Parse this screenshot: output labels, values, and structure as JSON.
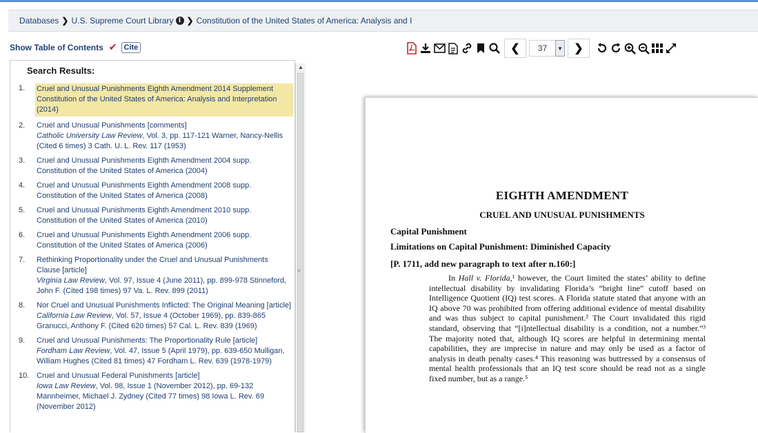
{
  "breadcrumb": {
    "items": [
      "Databases",
      "U.S. Supreme Court Library",
      "Constitution of the United States of America: Analysis and I"
    ]
  },
  "toc": {
    "show_label": "Show Table of Contents",
    "cite_label": "Cite"
  },
  "toolbar": {
    "page_number": "37"
  },
  "search": {
    "title": "Search Results:",
    "results": [
      {
        "num": "1.",
        "title": "Cruel and Unusual Punishments Eighth Amendment 2014 Supplement Constitution of the United States of America: Analysis and Interpretation (2014)",
        "journal": "",
        "rest": ""
      },
      {
        "num": "2.",
        "title": "Cruel and Unusual Punishments [comments]",
        "journal": "Catholic University Law Review",
        "rest": ", Vol. 3, pp. 117-121 Warner, Nancy-Nellis (Cited 6 times) 3 Cath. U. L. Rev. 117 (1953)"
      },
      {
        "num": "3.",
        "title": "Cruel and Unusual Punishments Eighth Amendment 2004 supp. Constitution of the United States of America (2004)",
        "journal": "",
        "rest": ""
      },
      {
        "num": "4.",
        "title": "Cruel and Unusual Punishments Eighth Amendment 2008 supp. Constitution of the United States of America (2008)",
        "journal": "",
        "rest": ""
      },
      {
        "num": "5.",
        "title": "Cruel and Unusual Punishments Eighth Amendment 2010 supp. Constitution of the United States of America (2010)",
        "journal": "",
        "rest": ""
      },
      {
        "num": "6.",
        "title": "Cruel and Unusual Punishments Eighth Amendment 2006 supp. Constitution of the United States of America (2006)",
        "journal": "",
        "rest": ""
      },
      {
        "num": "7.",
        "title": "Rethinking Proportionality under the Cruel and Unusual Punishments Clause [article]",
        "journal": "Virginia Law Review",
        "rest": ", Vol. 97, Issue 4 (June 2011), pp. 899-978 Stinneford, John F. (Cited 198 times) 97 Va. L. Rev. 899 (2011)"
      },
      {
        "num": "8.",
        "title": "Nor Cruel and Unusual Punishments Inflicted: The Original Meaning [article]",
        "journal": "California Law Review",
        "rest": ", Vol. 57, Issue 4 (October 1969), pp. 839-865 Granucci, Anthony F. (Cited 620 times) 57 Cal. L. Rev. 839 (1969)"
      },
      {
        "num": "9.",
        "title": "Cruel and Unusual Punishments: The Proportionality Rule [article]",
        "journal": "Fordham Law Review",
        "rest": ", Vol. 47, Issue 5 (April 1979), pp. 639-650 Mulligan, William Hughes (Cited 81 times) 47 Fordham L. Rev. 639 (1978-1979)"
      },
      {
        "num": "10.",
        "title": "Cruel and Unusual Federal Punishments [article]",
        "journal": "Iowa Law Review",
        "rest": ", Vol. 98, Issue 1 (November 2012), pp. 69-132 Mannheimer, Michael J. Zydney (Cited 77 times) 98 Iowa L. Rev. 69 (November 2012)"
      }
    ]
  },
  "document": {
    "heading": "EIGHTH AMENDMENT",
    "subheading": "CRUEL AND UNUSUAL PUNISHMENTS",
    "section": "Capital Punishment",
    "subsection": "Limitations on Capital Punishment: Diminished Capacity",
    "page_note": "[P. 1711, add new paragraph to text after n.160:]",
    "para_intro": "In ",
    "para_case": "Hall v. Florida",
    "para_body": ",¹ however, the Court limited the states’ ability to define intellectual disability by invalidating Florida’s “bright line” cutoff based on Intelligence Quotient (IQ) test scores. A Florida statute stated that anyone with an IQ above 70 was prohibited from offering additional evidence of mental disability and was thus subject to capital punishment.² The Court invalidated this rigid standard, observing that “[i]ntellectual disability is a condition, not a number.”³ The majority noted that, although IQ scores are helpful in determining mental capabilities, they are imprecise in nature and may only be used as a factor of analysis in death penalty cases.⁴ This reasoning was buttressed by a consensus of mental health professionals that an IQ test score should be read not as a single fixed number, but as a range.⁵"
  },
  "colors": {
    "link": "#1f3f74",
    "highlight": "#f3e7a6",
    "pdf_red": "#c0262b",
    "accent_line": "#5b8fd6"
  }
}
